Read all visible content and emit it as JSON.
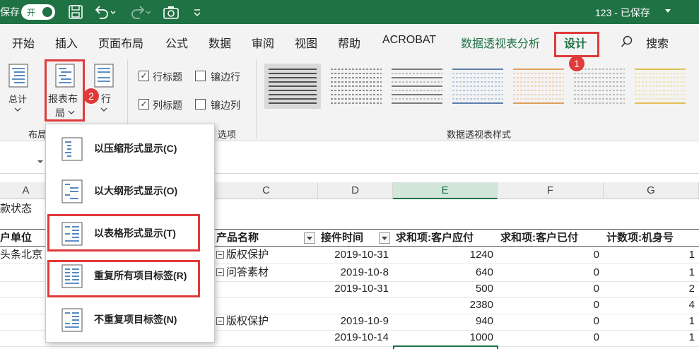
{
  "titlebar": {
    "autosave_label": "保存",
    "toggle_label": "开",
    "doc_title": "123 - 已保存"
  },
  "tabs": [
    {
      "label": "开始"
    },
    {
      "label": "插入"
    },
    {
      "label": "页面布局"
    },
    {
      "label": "公式"
    },
    {
      "label": "数据"
    },
    {
      "label": "审阅"
    },
    {
      "label": "视图"
    },
    {
      "label": "帮助"
    },
    {
      "label": "ACROBAT"
    },
    {
      "label": "数据透视表分析"
    },
    {
      "label": "设计"
    },
    {
      "label": "搜索"
    }
  ],
  "ribbon": {
    "subtotal_label": "总计",
    "report_layout_label_1": "报表布",
    "report_layout_label_2": "局",
    "blank_rows_label": "行",
    "layout_group_label": "布局",
    "options_group_label": "选项",
    "row_headers": "行标题",
    "banded_rows": "镶边行",
    "column_headers": "列标题",
    "banded_columns": "镶边列",
    "styles_group_label": "数据透视表样式",
    "row_headers_checked": true,
    "column_headers_checked": true,
    "banded_rows_checked": false,
    "banded_columns_checked": false
  },
  "annotations": {
    "badge_1": "1",
    "badge_2": "2"
  },
  "menu": {
    "items": [
      {
        "label": "以压缩形式显示(C)"
      },
      {
        "label": "以大纲形式显示(O)"
      },
      {
        "label": "以表格形式显示(T)"
      },
      {
        "label": "重复所有项目标签(R)"
      },
      {
        "label": "不重复项目标签(N)"
      }
    ]
  },
  "grid": {
    "columns": [
      "A",
      "C",
      "D",
      "E",
      "F",
      "G"
    ],
    "status_text": "款状态",
    "headers": {
      "a": "户单位",
      "c": "产品名称",
      "d": "接件时间",
      "e": "求和项:客户应付",
      "f": "求和项:客户已付",
      "g": "计数项:机身号"
    },
    "a_first": "头条北京",
    "rows": [
      {
        "c": "版权保护",
        "d": "2019-10-31",
        "e": "1240",
        "f": "0",
        "g": "1"
      },
      {
        "c": "问答素材",
        "d": "2019-10-8",
        "e": "640",
        "f": "0",
        "g": "1"
      },
      {
        "c": "",
        "d": "2019-10-31",
        "e": "500",
        "f": "0",
        "g": "2"
      },
      {
        "c": "",
        "d": "",
        "e": "2380",
        "f": "0",
        "g": "4"
      },
      {
        "c": "版权保护",
        "d": "2019-10-9",
        "e": "940",
        "f": "0",
        "g": "1"
      },
      {
        "c": "",
        "d": "2019-10-14",
        "e": "1000",
        "f": "0",
        "g": "1"
      }
    ]
  },
  "colors": {
    "excel_green": "#1f7244",
    "highlight_red": "#e03a3a"
  }
}
